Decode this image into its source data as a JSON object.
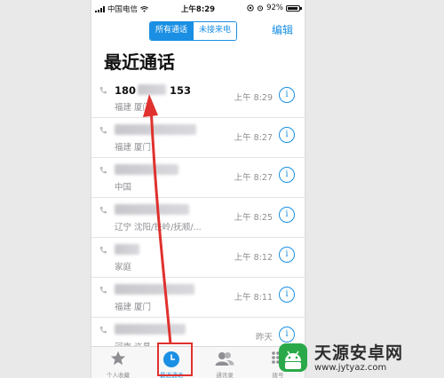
{
  "status_bar": {
    "carrier": "中国电信",
    "time": "上午8:29",
    "battery": "92%"
  },
  "header": {
    "segment_all": "所有通话",
    "segment_missed": "未接来电",
    "edit": "编辑",
    "title": "最近通话"
  },
  "calls": [
    {
      "name_prefix": "180",
      "name_suffix": "153",
      "location": "福建 厦门",
      "time": "上午 8:29"
    },
    {
      "name_prefix": "",
      "name_suffix": "",
      "location": "福建 厦门",
      "time": "上午 8:27"
    },
    {
      "name_prefix": "",
      "name_suffix": "",
      "location": "中国",
      "time": "上午 8:27"
    },
    {
      "name_prefix": "",
      "name_suffix": "",
      "location": "辽宁 沈阳/铁岭/抚顺/...",
      "time": "上午 8:25"
    },
    {
      "name_prefix": "",
      "name_suffix": "",
      "location": "家庭",
      "time": "上午 8:12"
    },
    {
      "name_prefix": "",
      "name_suffix": "",
      "location": "福建 厦门",
      "time": "上午 8:11"
    },
    {
      "name_prefix": "",
      "name_suffix": "",
      "location": "河南 许昌",
      "time": "昨天"
    }
  ],
  "tab_bar": {
    "favorites": "个人收藏",
    "recents": "最近通话",
    "contacts": "通讯录",
    "keypad": "拨号"
  },
  "watermark": {
    "name": "天源安卓网",
    "url": "www.jytyaz.com"
  },
  "colors": {
    "accent": "#1a8fe3",
    "annotation": "#e0312e"
  }
}
